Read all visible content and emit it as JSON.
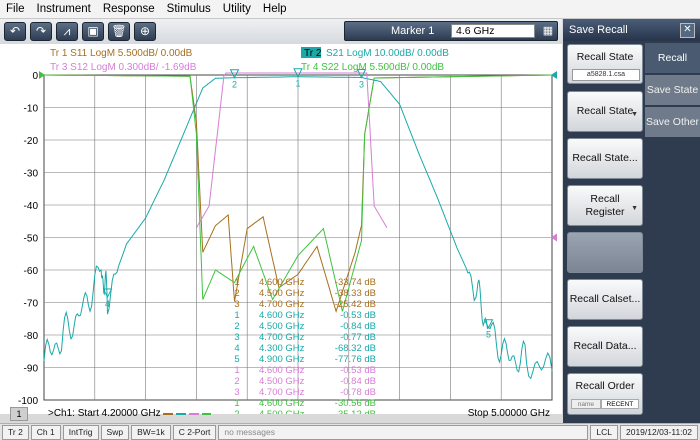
{
  "menu": [
    "File",
    "Instrument",
    "Response",
    "Stimulus",
    "Utility",
    "Help"
  ],
  "toolbar": {
    "buttons": [
      "undo-icon",
      "redo-icon",
      "marker-icon",
      "screen-capture-icon",
      "trash-icon",
      "zoom-icon"
    ],
    "glyphs": [
      "↶",
      "↷",
      "⩘",
      "▣",
      "🗑",
      "⊕"
    ]
  },
  "marker": {
    "label": "Marker 1",
    "value": "4.6 GHz",
    "kb": "▦"
  },
  "traces": [
    {
      "text": "Tr 1  S11 LogM 5.500dB/  0.00dB",
      "color": "#a66f1e"
    },
    {
      "text": "Tr 3  S12 LogM 0.300dB/  -1.69dB",
      "color": "#d67ed6"
    },
    {
      "text": "Tr 2",
      "color": "#1aa9a9"
    },
    {
      "text": "S21 LogM 10.00dB/  0.00dB",
      "color": "#1aa9a9"
    },
    {
      "text": "Tr 4  S22 LogM 5.500dB/  0.00dB",
      "color": "#3fc23f"
    }
  ],
  "y_ticks": [
    "0",
    "-10",
    "-20",
    "-30",
    "-40",
    "-50",
    "-60",
    "-70",
    "-80",
    "-90",
    "-100"
  ],
  "marker_table": [
    {
      "n": "1",
      "f": "4.600  GHz",
      "v": "-33.74 dB",
      "c": "#a66f1e"
    },
    {
      "n": "2",
      "f": "4.500  GHz",
      "v": "-38.33 dB",
      "c": "#a66f1e"
    },
    {
      "n": "3",
      "f": "4.700  GHz",
      "v": "-25.42 dB",
      "c": "#a66f1e"
    },
    {
      "n": "1",
      "f": "4.600  GHz",
      "v": "-0.53 dB",
      "c": "#1aa9a9"
    },
    {
      "n": "2",
      "f": "4.500  GHz",
      "v": "-0.84 dB",
      "c": "#1aa9a9"
    },
    {
      "n": "3",
      "f": "4.700  GHz",
      "v": "-0.77 dB",
      "c": "#1aa9a9"
    },
    {
      "n": "4",
      "f": "4.300  GHz",
      "v": "-68.32 dB",
      "c": "#1aa9a9"
    },
    {
      "n": "5",
      "f": "4.900  GHz",
      "v": "-77.76 dB",
      "c": "#1aa9a9"
    },
    {
      "n": "1",
      "f": "4.600  GHz",
      "v": "-0.53 dB",
      "c": "#d67ed6"
    },
    {
      "n": "2",
      "f": "4.500  GHz",
      "v": "-0.84 dB",
      "c": "#d67ed6"
    },
    {
      "n": "3",
      "f": "4.700  GHz",
      "v": "-0.78 dB",
      "c": "#d67ed6"
    },
    {
      "n": "1",
      "f": "4.600  GHz",
      "v": "-30.56 dB",
      "c": "#3fc23f"
    },
    {
      "n": "2",
      "f": "4.500  GHz",
      "v": "-35.12 dB",
      "c": "#3fc23f"
    }
  ],
  "footer": {
    "badge": "1",
    "start": ">Ch1:  Start  4.20000 GHz",
    "stop": "Stop  5.00000 GHz"
  },
  "status": [
    "Tr 2",
    "Ch 1",
    "IntTrig",
    "Swp",
    "BW=1k",
    "C  2-Port",
    "no messages",
    "LCL",
    "2019/12/03-11:02"
  ],
  "panel": {
    "title": "Save Recall",
    "close": "✕",
    "recall_state": "Recall State",
    "recall_state_file": "a5828.1.csa",
    "recall_state_menu": "Recall State",
    "recall_state_dots": "Recall State...",
    "recall_register": "Recall Register",
    "recall_calset": "Recall Calset...",
    "recall_data": "Recall Data...",
    "recall_order": "Recall Order",
    "order_name": "name",
    "order_recent": "RECENT",
    "tabs": [
      "Recall",
      "Save State",
      "Save Other"
    ]
  },
  "chart_data": {
    "type": "line",
    "xlim": [
      4.2,
      5.0
    ],
    "x_unit": "GHz",
    "grid": true,
    "series": [
      {
        "name": "S11",
        "color": "#a66f1e",
        "scale_per_div": 5.5,
        "ref": 0,
        "points": [
          [
            4.2,
            0
          ],
          [
            4.43,
            -0.2
          ],
          [
            4.44,
            -8
          ],
          [
            4.45,
            -30
          ],
          [
            4.47,
            -25.5
          ],
          [
            4.49,
            -23.7
          ],
          [
            4.5,
            -38.33
          ],
          [
            4.52,
            -26
          ],
          [
            4.545,
            -24
          ],
          [
            4.57,
            -36
          ],
          [
            4.6,
            -33.74
          ],
          [
            4.63,
            -29
          ],
          [
            4.66,
            -40
          ],
          [
            4.69,
            -30
          ],
          [
            4.7,
            -25.42
          ],
          [
            4.705,
            -10
          ],
          [
            4.72,
            -0.5
          ],
          [
            5.0,
            0
          ]
        ]
      },
      {
        "name": "S21",
        "color": "#1aa9a9",
        "scale_per_div": 10,
        "ref": 0,
        "points": [
          [
            4.2,
            -88
          ],
          [
            4.23,
            -80
          ],
          [
            4.26,
            -72
          ],
          [
            4.29,
            -60
          ],
          [
            4.3,
            -68.32
          ],
          [
            4.33,
            -52
          ],
          [
            4.36,
            -44
          ],
          [
            4.39,
            -32
          ],
          [
            4.42,
            -18
          ],
          [
            4.45,
            -4
          ],
          [
            4.47,
            -1
          ],
          [
            4.5,
            -0.84
          ],
          [
            4.6,
            -0.53
          ],
          [
            4.7,
            -0.77
          ],
          [
            4.73,
            -2
          ],
          [
            4.76,
            -9
          ],
          [
            4.79,
            -24
          ],
          [
            4.82,
            -38
          ],
          [
            4.85,
            -53
          ],
          [
            4.88,
            -66
          ],
          [
            4.9,
            -77.76
          ],
          [
            4.93,
            -86
          ],
          [
            4.96,
            -88
          ],
          [
            5.0,
            -91
          ]
        ]
      },
      {
        "name": "S12",
        "color": "#d67ed6",
        "scale_per_div": 0.3,
        "ref": -1.69,
        "points": [
          [
            4.44,
            -3.1
          ],
          [
            4.46,
            -2.9
          ],
          [
            4.5,
            -0.84
          ],
          [
            4.53,
            -0.65
          ],
          [
            4.6,
            -0.53
          ],
          [
            4.67,
            -0.65
          ],
          [
            4.7,
            -0.78
          ],
          [
            4.72,
            -2.9
          ],
          [
            4.74,
            -3.1
          ]
        ]
      },
      {
        "name": "S22",
        "color": "#3fc23f",
        "scale_per_div": 5.5,
        "ref": 0,
        "points": [
          [
            4.2,
            0
          ],
          [
            4.43,
            -0.2
          ],
          [
            4.44,
            -10
          ],
          [
            4.45,
            -38
          ],
          [
            4.47,
            -33
          ],
          [
            4.5,
            -35.12
          ],
          [
            4.53,
            -29
          ],
          [
            4.56,
            -38
          ],
          [
            4.6,
            -30.56
          ],
          [
            4.64,
            -26
          ],
          [
            4.67,
            -40
          ],
          [
            4.7,
            -28
          ],
          [
            4.705,
            -10
          ],
          [
            4.72,
            -0.5
          ],
          [
            5.0,
            0
          ]
        ]
      }
    ]
  }
}
